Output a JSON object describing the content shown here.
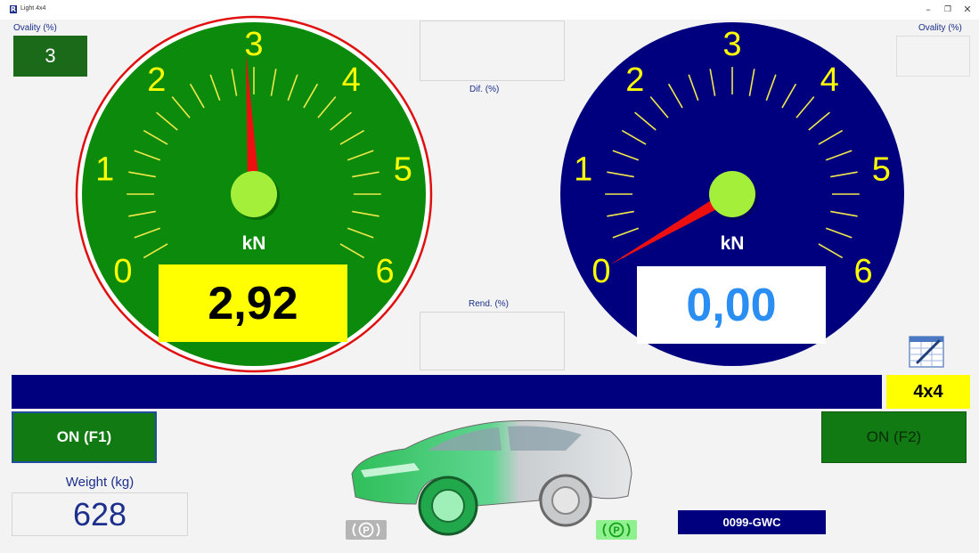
{
  "window": {
    "title": "Light 4x4",
    "app_icon_letter": "R",
    "minimize": "–",
    "restore": "❐",
    "close": "✕"
  },
  "left_panel": {
    "ovality_label": "Ovality (%)",
    "ovality_value": "3",
    "gauge": {
      "unit": "kN",
      "scale": [
        "0",
        "1",
        "2",
        "3",
        "4",
        "5",
        "6"
      ],
      "min": 0,
      "max": 6,
      "needle_value": 2.92,
      "display_value": "2,92",
      "face_color": "#0b8a0b",
      "highlighted": true
    }
  },
  "center": {
    "dif_label": "Dif. (%)",
    "rend_label": "Rend. (%)"
  },
  "right_panel": {
    "ovality_label": "Ovality (%)",
    "ovality_value": "",
    "gauge": {
      "unit": "kN",
      "scale": [
        "0",
        "1",
        "2",
        "3",
        "4",
        "5",
        "6"
      ],
      "min": 0,
      "max": 6,
      "needle_value": 0.0,
      "display_value": "0,00",
      "face_color": "#00007f"
    }
  },
  "status": {
    "progress": 0,
    "mode": "4x4"
  },
  "buttons": {
    "f1_label": "ON (F1)",
    "f2_label": "ON (F2)"
  },
  "weight": {
    "label": "Weight (kg)",
    "value": "628"
  },
  "vehicle": {
    "plate": "0099-GWC",
    "park_symbol": "(P)",
    "icon": "car-illustration"
  },
  "icons": {
    "report": "report-table-icon"
  }
}
